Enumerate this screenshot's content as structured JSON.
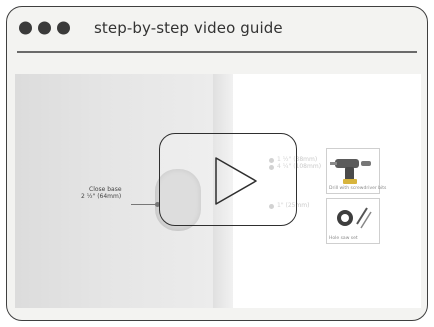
{
  "window": {
    "title": "step-by-step video guide",
    "controls": [
      "dot-1",
      "dot-2",
      "dot-3"
    ]
  },
  "video": {
    "play_icon": "play-triangle-icon",
    "annotations": {
      "left_line1": "Close base",
      "left_line2": "2 ½\" (64mm)",
      "right_line1": "1 ½\" (38mm)",
      "right_line2": "4 ¼\" (108mm)",
      "right_line3": "1\" (25mm)"
    },
    "tools": {
      "drill_caption": "Drill with screwdriver bits",
      "hole_caption": "Hole saw set"
    }
  },
  "colors": {
    "frame": "#3f3f3f",
    "window_bg": "#f3f3f1",
    "dots": "#3a3a3a",
    "divider": "#6a6a6a"
  }
}
